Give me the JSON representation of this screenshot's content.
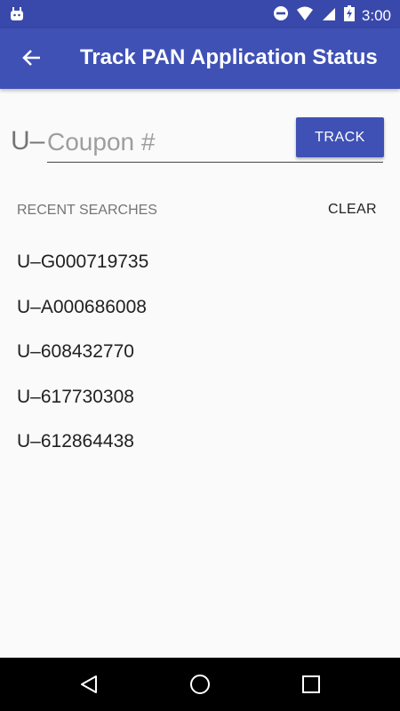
{
  "status_bar": {
    "time": "3:00"
  },
  "app_bar": {
    "title": "Track PAN Application Status"
  },
  "search": {
    "prefix": "U–",
    "placeholder": "Coupon #",
    "value": "",
    "track_label": "TRACK"
  },
  "recent": {
    "header": "RECENT SEARCHES",
    "clear_label": "CLEAR",
    "items": [
      "U–G000719735",
      "U–A000686008",
      "U–608432770",
      "U–617730308",
      "U–612864438"
    ]
  },
  "colors": {
    "primary": "#3f51b5",
    "primary_dark": "#3949ab"
  }
}
